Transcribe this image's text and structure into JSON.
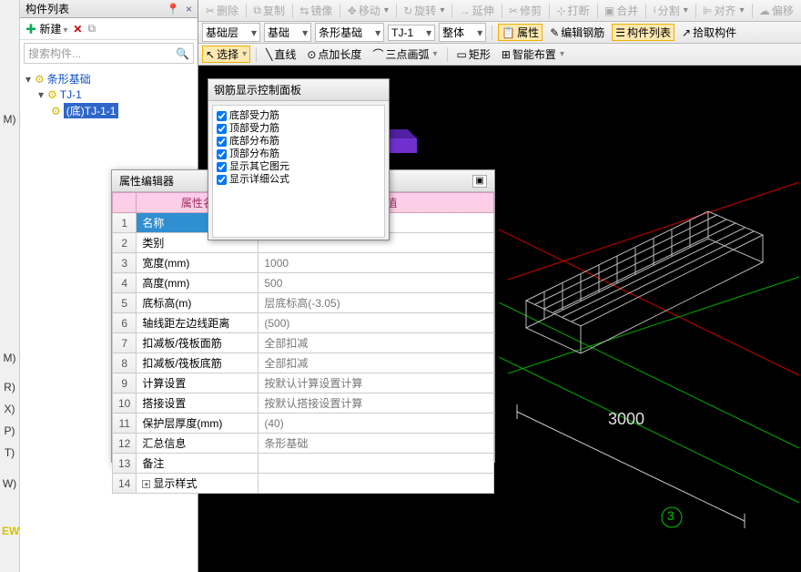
{
  "left_strip": {
    "labels": [
      "M)",
      "M)",
      "R)",
      "X)",
      "P)",
      "T)",
      "W)"
    ],
    "yellow_label": "EW"
  },
  "panel": {
    "title": "构件列表",
    "pin_icon": "📌",
    "close_icon": "×",
    "new_label": "新建",
    "search_placeholder": "搜索构件...",
    "tree_root": "条形基础",
    "tree_child": "TJ-1",
    "tree_leaf": "(底)TJ-1-1"
  },
  "toolbar1": {
    "items": [
      "删除",
      "复制",
      "镜像",
      "移动",
      "旋转",
      "延伸",
      "修剪",
      "打断",
      "合并",
      "分割",
      "对齐",
      "偏移"
    ]
  },
  "toolbar2": {
    "dd1": "基础层",
    "dd2": "基础",
    "dd3": "条形基础",
    "dd4": "TJ-1",
    "dd5": "整体",
    "b1": "属性",
    "b2": "编辑钢筋",
    "b3": "构件列表",
    "b4": "拾取构件"
  },
  "toolbar3": {
    "b1": "选择",
    "b2": "直线",
    "b3": "点加长度",
    "b4": "三点画弧",
    "b5": "矩形",
    "b6": "智能布置"
  },
  "rebar_dialog": {
    "title": "钢筋显示控制面板",
    "items": [
      "底部受力筋",
      "顶部受力筋",
      "底部分布筋",
      "顶部分布筋",
      "显示其它图元",
      "显示详细公式"
    ]
  },
  "property_editor": {
    "title": "属性编辑器",
    "col_name": "属性名",
    "col_val": "值",
    "rows": [
      {
        "n": "1",
        "name": "名称",
        "val": ""
      },
      {
        "n": "2",
        "name": "类别",
        "val": ""
      },
      {
        "n": "3",
        "name": "宽度(mm)",
        "val": "1000"
      },
      {
        "n": "4",
        "name": "高度(mm)",
        "val": "500"
      },
      {
        "n": "5",
        "name": "底标高(m)",
        "val": "层底标高(-3.05)"
      },
      {
        "n": "6",
        "name": "轴线距左边线距离",
        "val": "(500)"
      },
      {
        "n": "7",
        "name": "扣减板/筏板面筋",
        "val": "全部扣减"
      },
      {
        "n": "8",
        "name": "扣减板/筏板底筋",
        "val": "全部扣减"
      },
      {
        "n": "9",
        "name": "计算设置",
        "val": "按默认计算设置计算"
      },
      {
        "n": "10",
        "name": "搭接设置",
        "val": "按默认搭接设置计算"
      },
      {
        "n": "11",
        "name": "保护层厚度(mm)",
        "val": "(40)"
      },
      {
        "n": "12",
        "name": "汇总信息",
        "val": "条形基础"
      },
      {
        "n": "13",
        "name": "备注",
        "val": ""
      },
      {
        "n": "14",
        "name": "显示样式",
        "val": "",
        "expand": true
      }
    ]
  },
  "viewport": {
    "dim_3000": "3000",
    "node_3": "3"
  }
}
